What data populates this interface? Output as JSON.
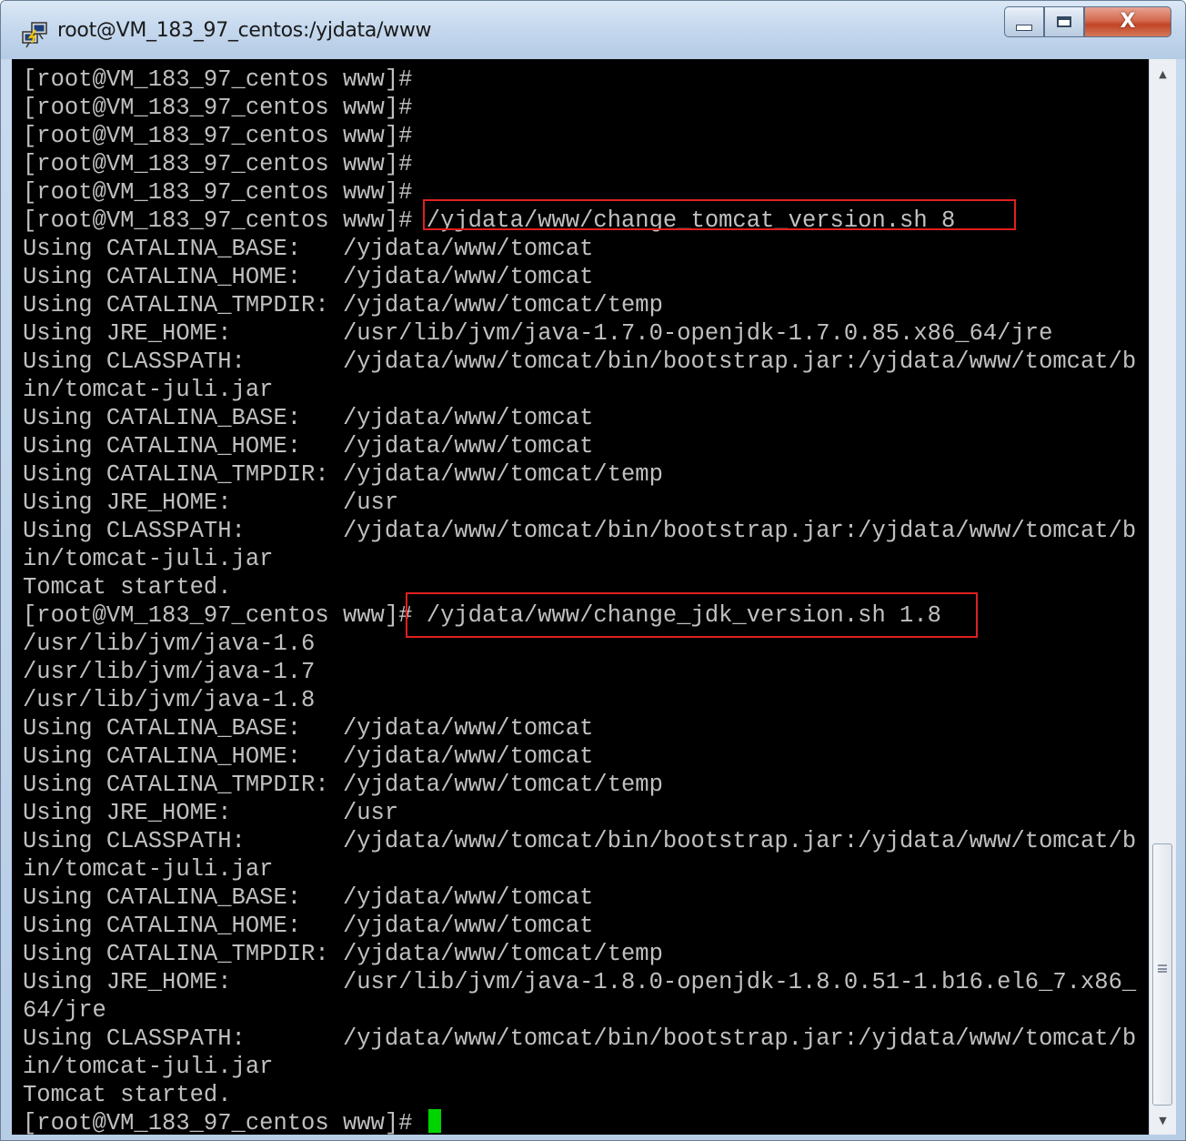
{
  "window": {
    "title": "root@VM_183_97_centos:/yjdata/www",
    "icon": "putty-terminal-icon",
    "controls": {
      "minimize": "minimize-icon",
      "maximize": "maximize-icon",
      "close": "close-icon"
    }
  },
  "terminal": {
    "background": "#000000",
    "text_color": "#c0c0c0",
    "cursor_color": "#00d400",
    "highlight_color": "#e02020",
    "lines": [
      "[root@VM_183_97_centos www]#",
      "[root@VM_183_97_centos www]#",
      "[root@VM_183_97_centos www]#",
      "[root@VM_183_97_centos www]#",
      "[root@VM_183_97_centos www]#",
      "[root@VM_183_97_centos www]# /yjdata/www/change_tomcat_version.sh 8",
      "Using CATALINA_BASE:   /yjdata/www/tomcat",
      "Using CATALINA_HOME:   /yjdata/www/tomcat",
      "Using CATALINA_TMPDIR: /yjdata/www/tomcat/temp",
      "Using JRE_HOME:        /usr/lib/jvm/java-1.7.0-openjdk-1.7.0.85.x86_64/jre",
      "Using CLASSPATH:       /yjdata/www/tomcat/bin/bootstrap.jar:/yjdata/www/tomcat/b",
      "in/tomcat-juli.jar",
      "Using CATALINA_BASE:   /yjdata/www/tomcat",
      "Using CATALINA_HOME:   /yjdata/www/tomcat",
      "Using CATALINA_TMPDIR: /yjdata/www/tomcat/temp",
      "Using JRE_HOME:        /usr",
      "Using CLASSPATH:       /yjdata/www/tomcat/bin/bootstrap.jar:/yjdata/www/tomcat/b",
      "in/tomcat-juli.jar",
      "Tomcat started.",
      "[root@VM_183_97_centos www]# /yjdata/www/change_jdk_version.sh 1.8",
      "/usr/lib/jvm/java-1.6",
      "/usr/lib/jvm/java-1.7",
      "/usr/lib/jvm/java-1.8",
      "Using CATALINA_BASE:   /yjdata/www/tomcat",
      "Using CATALINA_HOME:   /yjdata/www/tomcat",
      "Using CATALINA_TMPDIR: /yjdata/www/tomcat/temp",
      "Using JRE_HOME:        /usr",
      "Using CLASSPATH:       /yjdata/www/tomcat/bin/bootstrap.jar:/yjdata/www/tomcat/b",
      "in/tomcat-juli.jar",
      "Using CATALINA_BASE:   /yjdata/www/tomcat",
      "Using CATALINA_HOME:   /yjdata/www/tomcat",
      "Using CATALINA_TMPDIR: /yjdata/www/tomcat/temp",
      "Using JRE_HOME:        /usr/lib/jvm/java-1.8.0-openjdk-1.8.0.51-1.b16.el6_7.x86_",
      "64/jre",
      "Using CLASSPATH:       /yjdata/www/tomcat/bin/bootstrap.jar:/yjdata/www/tomcat/b",
      "in/tomcat-juli.jar",
      "Tomcat started.",
      "[root@VM_183_97_centos www]# "
    ]
  },
  "scrollbar": {
    "up_arrow": "scroll-up-arrow-icon",
    "down_arrow": "scroll-down-arrow-icon",
    "position_fraction": 0.73
  }
}
